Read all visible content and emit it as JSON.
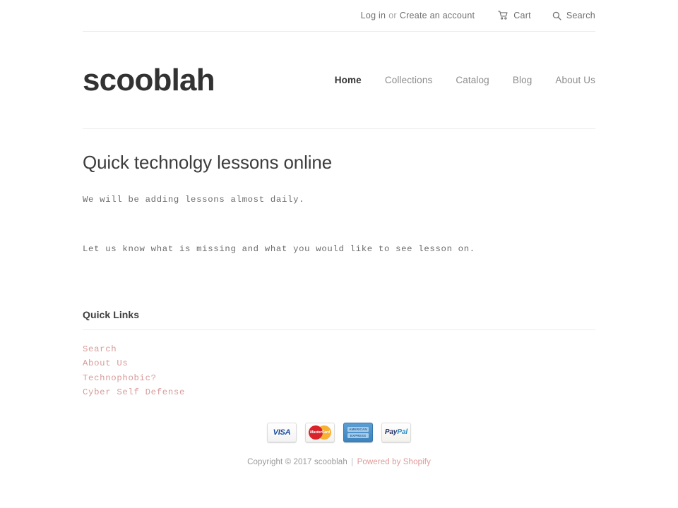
{
  "site": {
    "logo": "scooblah"
  },
  "utility": {
    "login_label": "Log in",
    "or_label": "or",
    "create_account_label": "Create an account",
    "cart_label": "Cart",
    "cart_icon": "shopping-cart-icon",
    "search_label": "Search",
    "search_icon": "magnifier-icon"
  },
  "nav": {
    "items": [
      {
        "label": "Home",
        "active": true
      },
      {
        "label": "Collections",
        "active": false
      },
      {
        "label": "Catalog",
        "active": false
      },
      {
        "label": "Blog",
        "active": false
      },
      {
        "label": "About Us",
        "active": false
      }
    ]
  },
  "main": {
    "title": "Quick technolgy lessons online",
    "paragraph_1": "We will be adding lessons almost daily.",
    "paragraph_2": "Let us know what is missing and what you would like to see lesson on."
  },
  "footer": {
    "quick_links_heading": "Quick Links",
    "quick_links": [
      {
        "label": "Search"
      },
      {
        "label": "About Us"
      },
      {
        "label": "Technophobic?"
      },
      {
        "label": "Cyber Self Defense"
      }
    ],
    "payment_methods": [
      {
        "name": "visa",
        "label": "VISA"
      },
      {
        "name": "mastercard",
        "label": "MasterCard"
      },
      {
        "name": "american-express",
        "label_top": "AMERICAN",
        "label_bottom": "EXPRESS"
      },
      {
        "name": "paypal",
        "label_pay": "Pay",
        "label_pal": "Pal"
      }
    ],
    "copyright_text": "Copyright © 2017 scooblah",
    "copyright_separator": "|",
    "powered_by_label": "Powered by Shopify"
  },
  "colors": {
    "link_accent": "#d99a9a",
    "text_dark": "#333333",
    "text_muted": "#8c8c8c",
    "rule": "#ececec"
  }
}
